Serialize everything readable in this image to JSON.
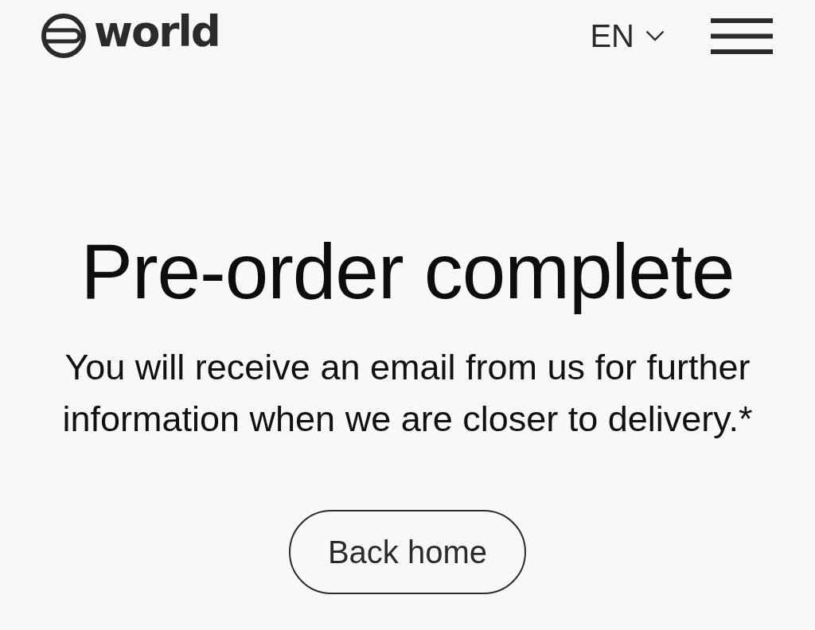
{
  "header": {
    "logo_text": "world",
    "language": "EN"
  },
  "main": {
    "title": "Pre-order complete",
    "message": "You will receive an email from us for further information when we are closer to delivery.*",
    "button": "Back home"
  }
}
